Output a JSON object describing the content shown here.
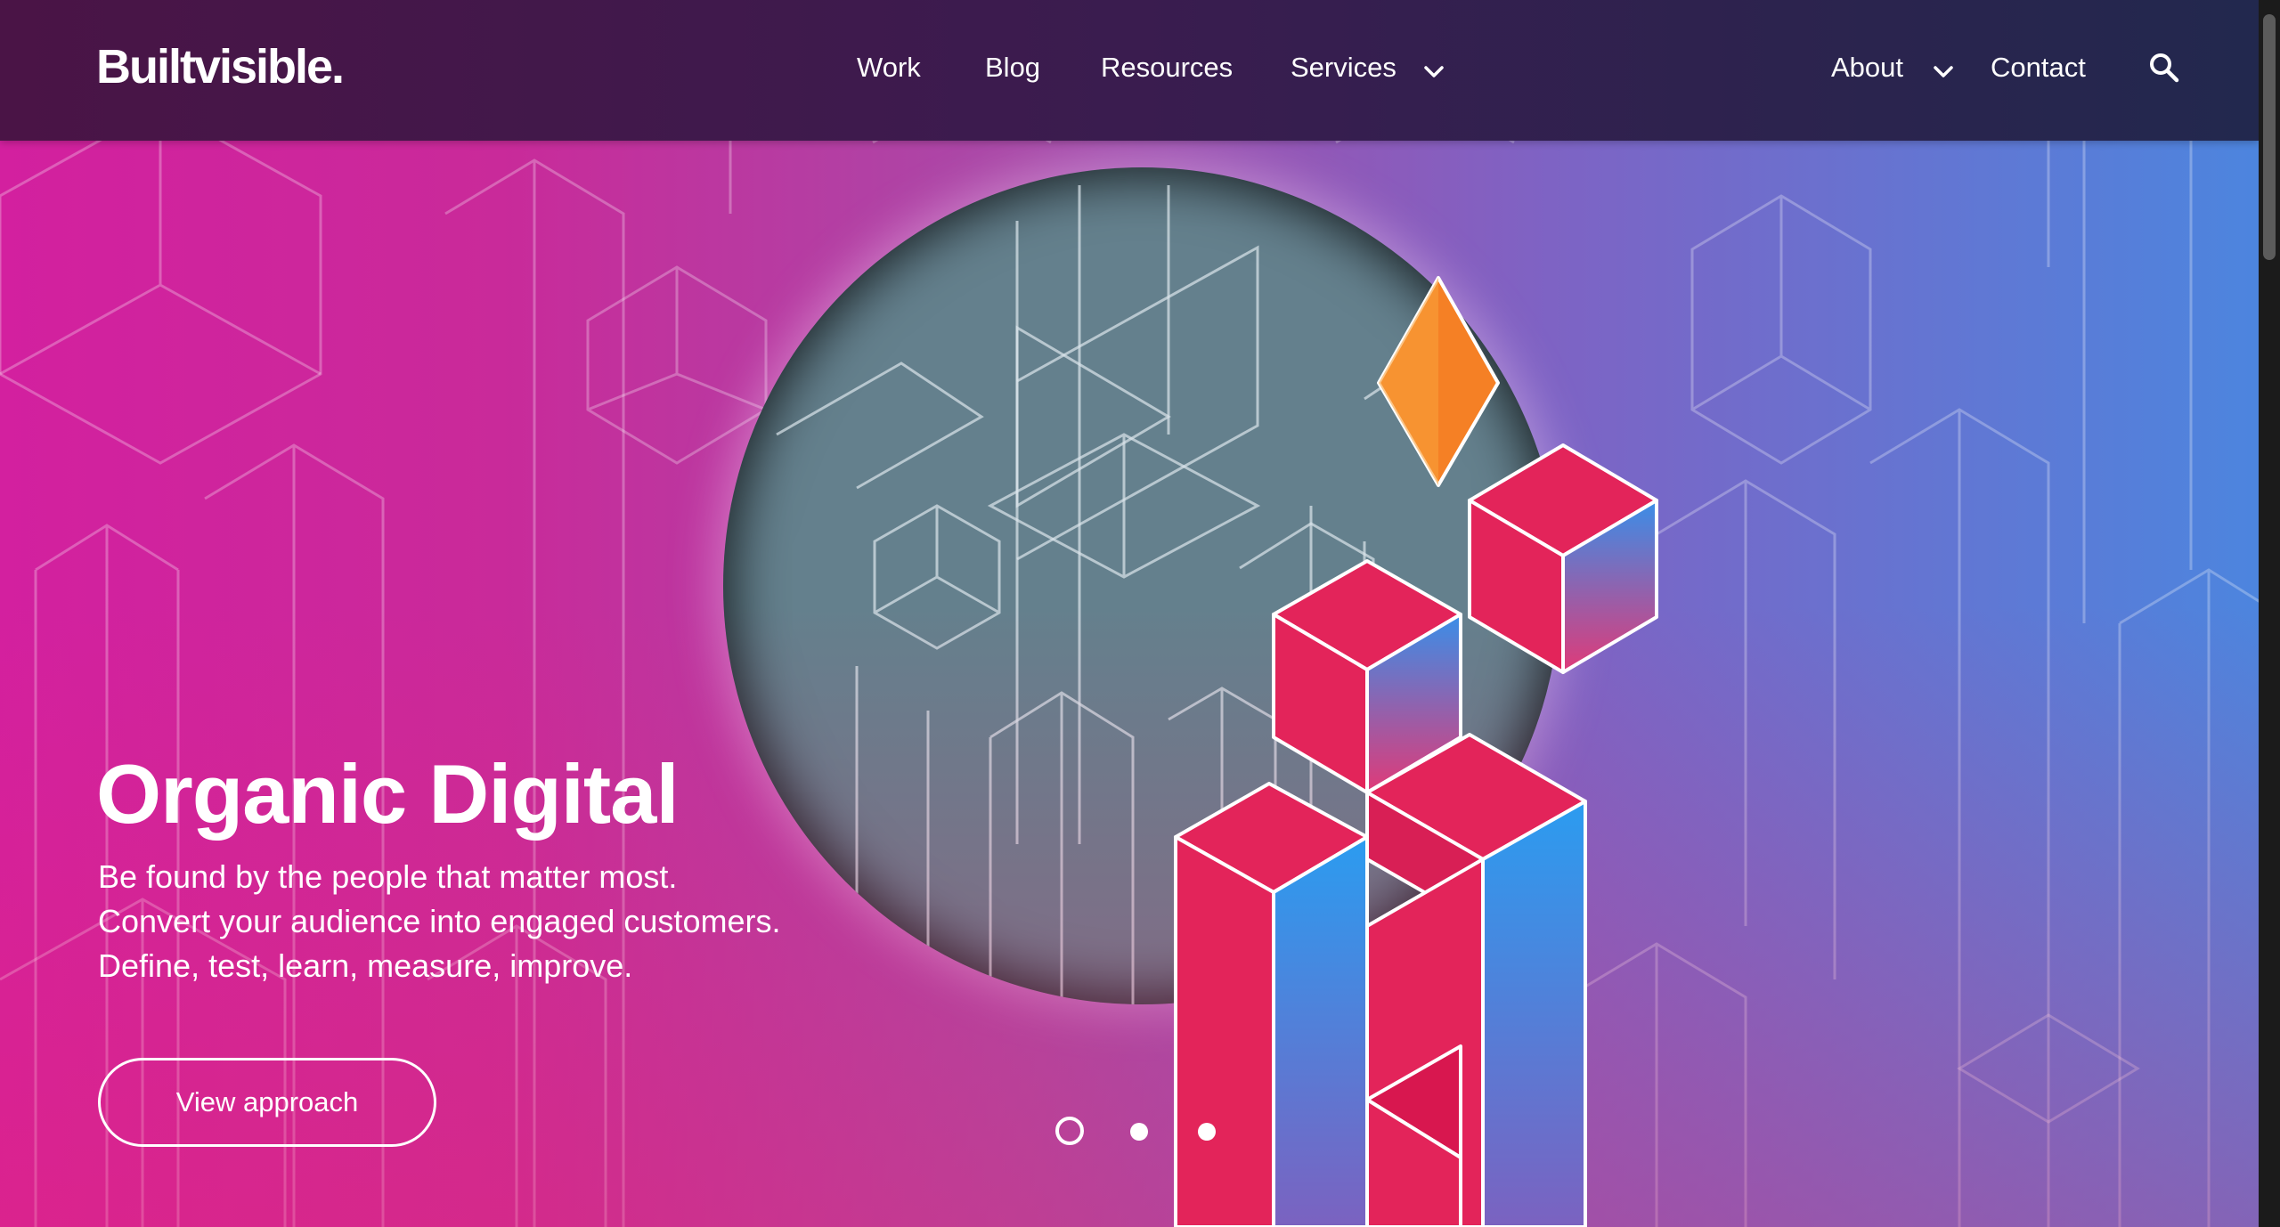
{
  "brand": {
    "logo_text": "Builtvisible."
  },
  "nav": {
    "items": [
      "Work",
      "Blog",
      "Resources",
      "Services",
      "About",
      "Contact"
    ],
    "icons": {
      "dropdown": "chevron-down-icon",
      "search": "search-icon"
    }
  },
  "hero": {
    "title": "Organic Digital",
    "lines": [
      "Be found by the people that matter most.",
      "Convert your audience into engaged customers.",
      "Define, test, learn, measure, improve."
    ],
    "cta_label": "View approach",
    "carousel": {
      "slides": 3,
      "active": 1
    }
  },
  "colors": {
    "nav_bg": "#3a1c4f",
    "accent_pink": "#e8265f",
    "accent_blue": "#2b9cf0",
    "diamond_orange": "#f58025"
  }
}
